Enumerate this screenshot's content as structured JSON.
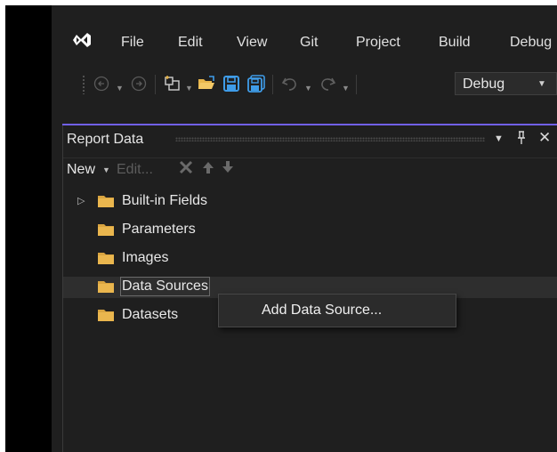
{
  "menu": {
    "items": [
      "File",
      "Edit",
      "View",
      "Git",
      "Project",
      "Build",
      "Debug"
    ]
  },
  "toolbar": {
    "configuration": "Debug",
    "icons": [
      "back-icon",
      "forward-icon",
      "new-project-icon",
      "open-icon",
      "save-icon",
      "save-all-icon",
      "undo-icon",
      "redo-icon"
    ]
  },
  "report_data": {
    "title": "Report Data",
    "toolbar": {
      "new_label": "New",
      "edit_label": "Edit..."
    },
    "tree": [
      {
        "label": "Built-in Fields",
        "expandable": true
      },
      {
        "label": "Parameters",
        "expandable": false
      },
      {
        "label": "Images",
        "expandable": false
      },
      {
        "label": "Data Sources",
        "expandable": false,
        "selected": true
      },
      {
        "label": "Datasets",
        "expandable": false
      }
    ]
  },
  "context_menu": {
    "items": [
      "Add Data Source..."
    ]
  },
  "colors": {
    "background": "#1f1f1f",
    "accent": "#7160e8",
    "folder": "#e8b64c",
    "toolbar_blue": "#3f9ce8"
  }
}
